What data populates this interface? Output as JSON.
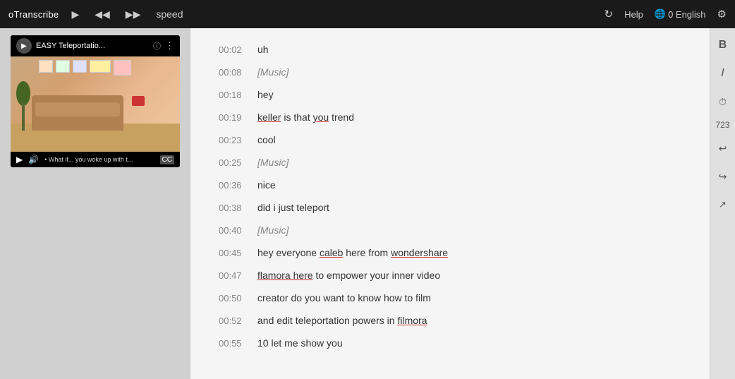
{
  "topbar": {
    "logo": "oTranscribe",
    "play_label": "▶",
    "rewind_label": "◀◀",
    "forward_label": "▶▶",
    "speed_label": "speed",
    "refresh_label": "↻",
    "help_label": "Help",
    "lang_label": "0 English",
    "settings_label": "⚙"
  },
  "video": {
    "title": "EASY Teleportatio...",
    "info_btn": "ⓘ",
    "more_btn": "⋮",
    "caption_label": "CC",
    "time_text": "• What if... you woke up with t..."
  },
  "toolbar": {
    "bold_label": "B",
    "italic_label": "I",
    "clock_label": "🕐",
    "count": "723",
    "undo_label": "↩",
    "redo_label": "↪",
    "export_label": "↗"
  },
  "transcript": {
    "rows": [
      {
        "time": "00:02",
        "text": "uh",
        "type": "normal"
      },
      {
        "time": "00:08",
        "text": "[Music]",
        "type": "tag"
      },
      {
        "time": "00:18",
        "text": "hey",
        "type": "normal"
      },
      {
        "time": "00:19",
        "text": "keller is that you trend",
        "type": "special1"
      },
      {
        "time": "00:23",
        "text": "cool",
        "type": "normal"
      },
      {
        "time": "00:25",
        "text": "[Music]",
        "type": "tag"
      },
      {
        "time": "00:36",
        "text": "nice",
        "type": "normal"
      },
      {
        "time": "00:38",
        "text": "did i just teleport",
        "type": "normal"
      },
      {
        "time": "00:40",
        "text": "[Music]",
        "type": "tag"
      },
      {
        "time": "00:45",
        "text": "hey everyone caleb here from wondershare",
        "type": "special2"
      },
      {
        "time": "00:47",
        "text": "flamora here to empower your inner video",
        "type": "special3"
      },
      {
        "time": "00:50",
        "text": "creator do you want to know how to film",
        "type": "normal"
      },
      {
        "time": "00:52",
        "text": "and edit teleportation powers in filmora",
        "type": "special4"
      },
      {
        "time": "00:55",
        "text": "10 let me show you",
        "type": "normal"
      }
    ]
  }
}
